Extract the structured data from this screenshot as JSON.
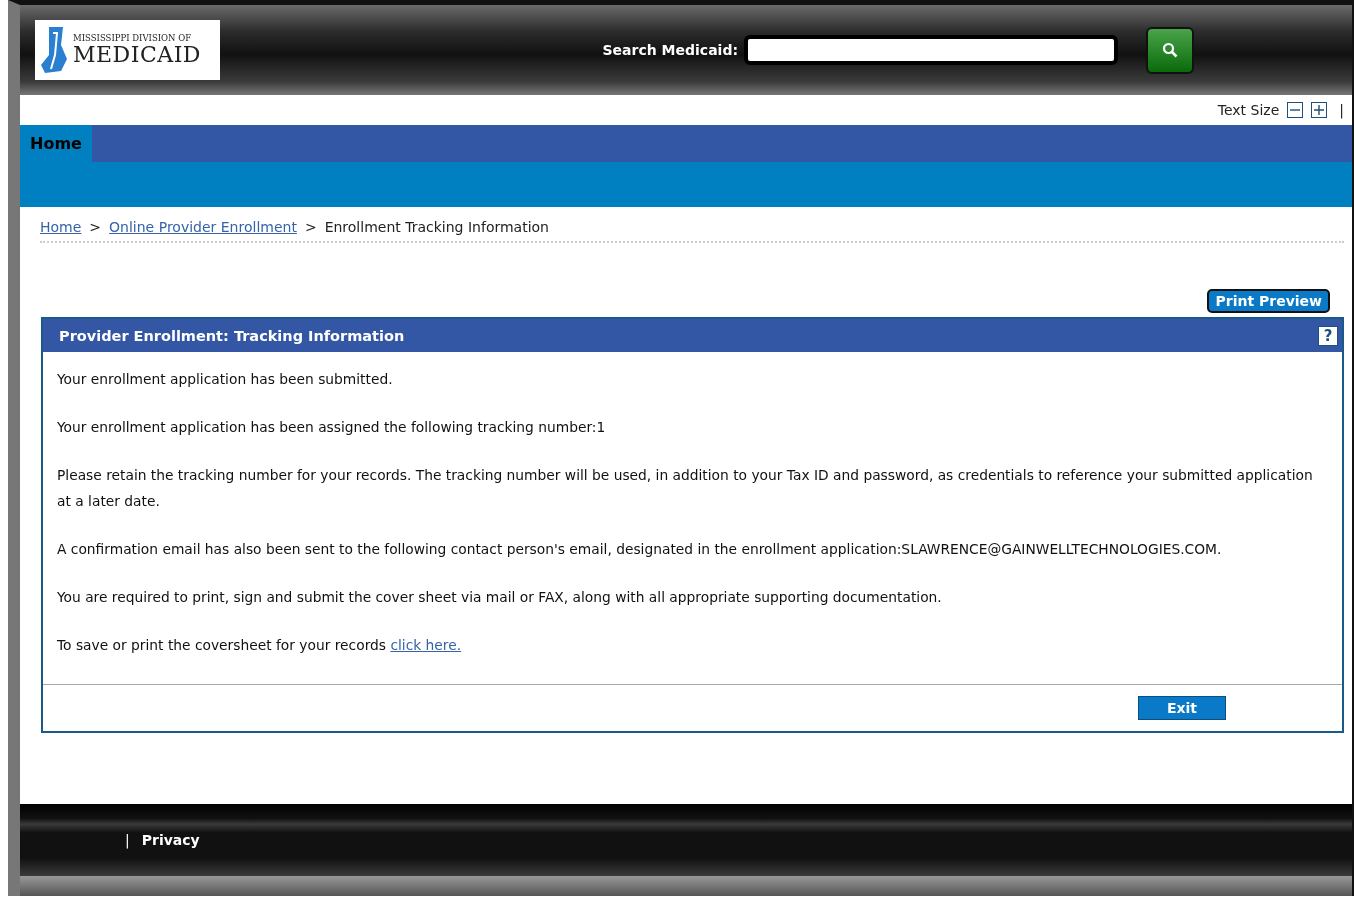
{
  "header": {
    "logo": {
      "line1": "MISSISSIPPI DIVISION OF",
      "line2": "MEDICAID"
    },
    "search": {
      "label": "Search Medicaid:"
    }
  },
  "text_size": {
    "label": "Text Size",
    "separator": "|"
  },
  "nav": {
    "tabs": [
      {
        "label": "Home",
        "selected": true
      }
    ]
  },
  "breadcrumb": [
    {
      "label": "Home",
      "link": true
    },
    {
      "label": "Online Provider Enrollment",
      "link": true
    },
    {
      "label": "Enrollment Tracking Information",
      "link": false
    }
  ],
  "breadcrumb_separator": ">",
  "print_preview": "Print Preview",
  "panel": {
    "title": "Provider Enrollment: Tracking Information",
    "help": "?",
    "paragraphs": [
      "Your enrollment application has been submitted.",
      "Your enrollment application has been assigned the following tracking number:1",
      "Please retain the tracking number for your records. The tracking number will be used, in addition to your Tax ID and password, as credentials to reference your submitted application at a later date.",
      "A confirmation email has also been sent to the following contact person's email, designated in the enrollment application:SLAWRENCE@GAINWELLTECHNOLOGIES.COM.",
      "You are required to print, sign and submit the cover sheet via mail or FAX, along with all appropriate supporting documentation."
    ],
    "link_paragraph": {
      "text": "To save or print the coversheet for your records",
      "link": "click here."
    },
    "exit": "Exit"
  },
  "footer": {
    "separator": "|",
    "link": "Privacy"
  }
}
